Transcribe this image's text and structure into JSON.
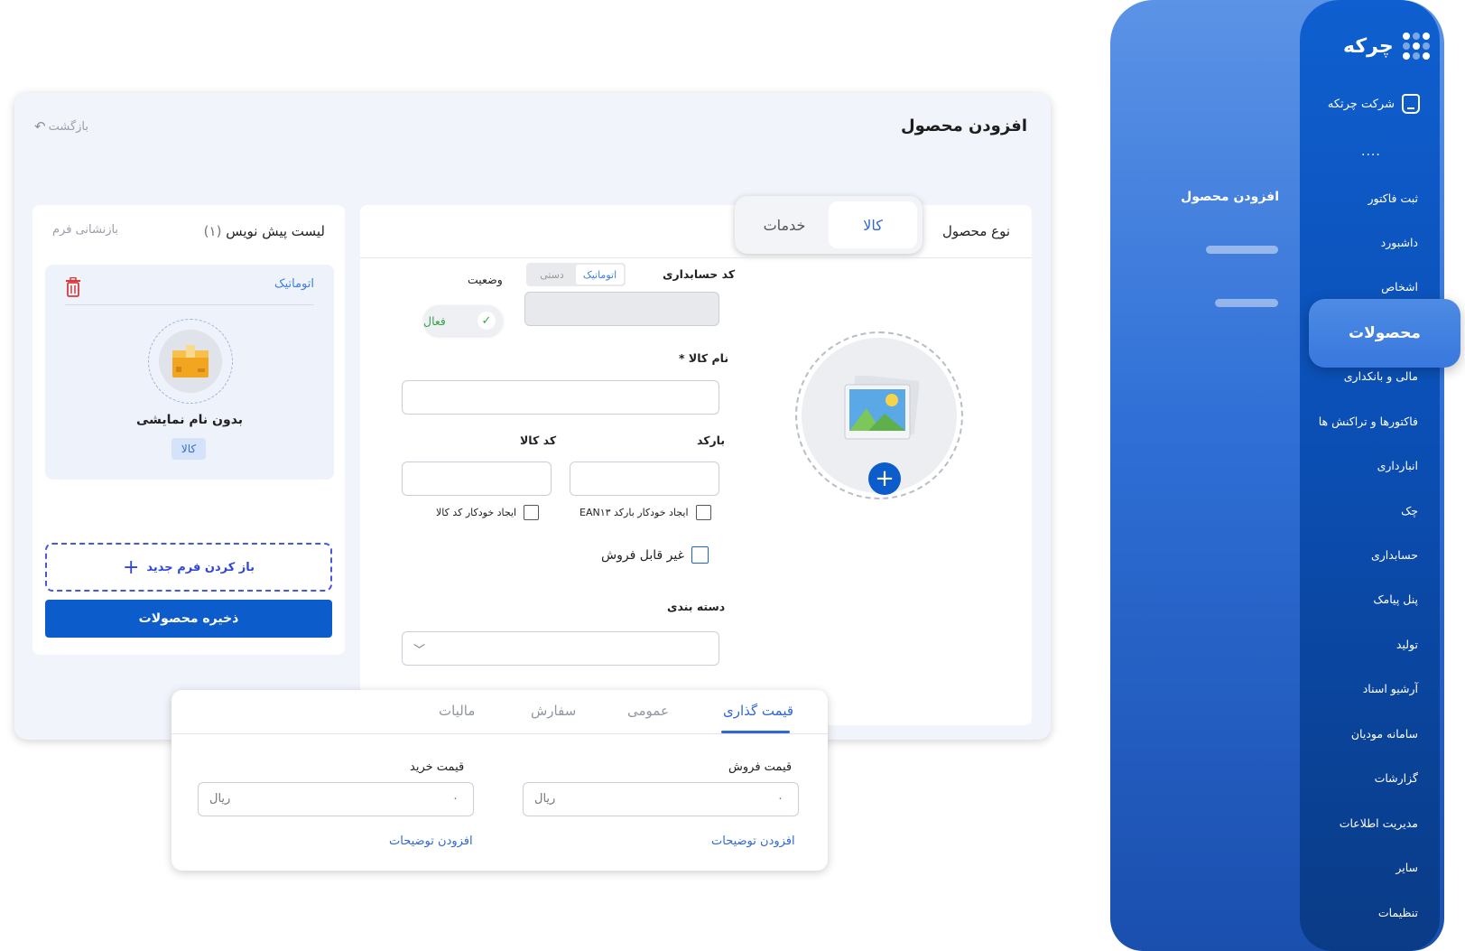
{
  "sidebar": {
    "brand": "چرکه",
    "company": "شرکت چرتکه",
    "more": "....",
    "items": [
      {
        "label": "ثبت فاکتور"
      },
      {
        "label": "داشبورد"
      },
      {
        "label": "اشخاص"
      },
      {
        "label": "محصولات"
      },
      {
        "label": "مالی و بانکداری"
      },
      {
        "label": "فاکتورها و تراکنش ها"
      },
      {
        "label": "انبارداری"
      },
      {
        "label": "چک"
      },
      {
        "label": "حسابداری"
      },
      {
        "label": "پنل پیامک"
      },
      {
        "label": "تولید"
      },
      {
        "label": "آرشیو اسناد"
      },
      {
        "label": "سامانه مودیان"
      },
      {
        "label": "گزارشات"
      },
      {
        "label": "مدیریت اطلاعات"
      },
      {
        "label": "سایر"
      },
      {
        "label": "تنظیمات"
      }
    ],
    "active_item": "محصولات",
    "submenu_title": "افزودن محصول"
  },
  "page": {
    "title": "افزودن محصول",
    "back": "بازگشت"
  },
  "drafts": {
    "title": "لیست پیش نویس",
    "count": "(۱)",
    "reset": "بازنشانی فرم",
    "item": {
      "mode": "اتوماتیک",
      "name": "بدون نام نمایشی",
      "badge": "کالا"
    },
    "open_form": "باز کردن فرم جدید",
    "save": "ذخیره محصولات"
  },
  "form": {
    "type_label": "نوع محصول",
    "type_options": [
      "کالا",
      "خدمات"
    ],
    "type_selected": "کالا",
    "accounting_code_label": "کد حسابداری",
    "mode_options": [
      "اتوماتیک",
      "دستی"
    ],
    "mode_selected": "اتوماتیک",
    "status_label": "وضعیت",
    "status_value": "فعال",
    "name_label": "نام کالا *",
    "barcode_label": "بارکد",
    "code_label": "کد کالا",
    "auto_barcode": "ایجاد خودکار بارکد EAN۱۳",
    "auto_code": "ایجاد خودکار کد کالا",
    "not_for_sale": "غیر قابل فروش",
    "category_label": "دسته بندی"
  },
  "pricing": {
    "tabs": [
      "قیمت گذاری",
      "عمومی",
      "سفارش",
      "مالیات"
    ],
    "active_tab": "قیمت گذاری",
    "sell_label": "قیمت فروش",
    "buy_label": "قیمت خرید",
    "sell_value": "۰",
    "buy_value": "۰",
    "currency": "ریال",
    "add_description": "افزودن توضیحات"
  },
  "colors": {
    "primary": "#0d5ccc",
    "accent_blue": "#2f67d6",
    "sidebar_gradient_top": "#5b93e6",
    "sidebar_gradient_bottom": "#0a3b86",
    "success": "#3aa34a",
    "danger": "#d93a3a"
  },
  "icons": [
    "home-icon",
    "back-arrow-icon",
    "trash-icon",
    "box-icon",
    "image-placeholder-icon",
    "plus-icon",
    "check-icon",
    "chevron-down-icon",
    "logo-icon"
  ]
}
